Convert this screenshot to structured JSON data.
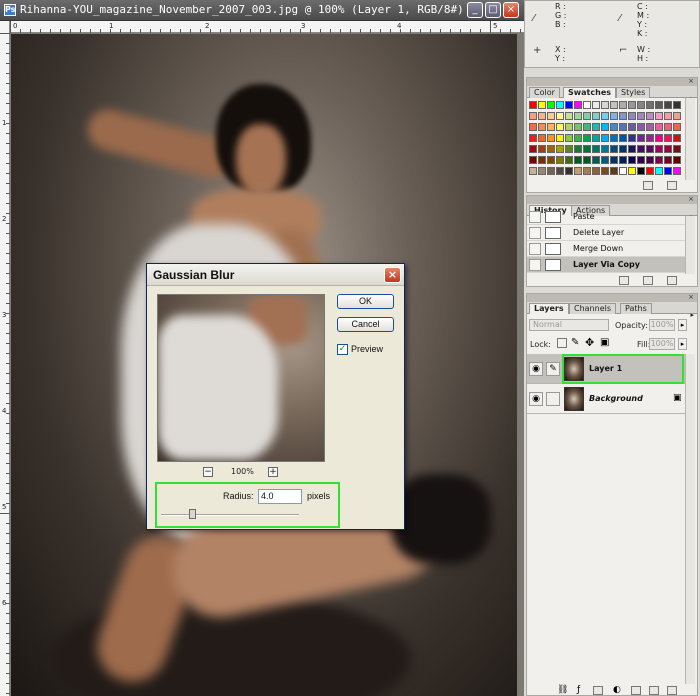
{
  "document": {
    "title": "Rihanna-YOU_magazine_November_2007_003.jpg @ 100% (Layer 1, RGB/8#)",
    "icon": "Ps",
    "minimize": "_",
    "maximize": "□",
    "close": "×"
  },
  "rulers": {
    "top": [
      "0",
      "1",
      "2",
      "3",
      "4",
      "5"
    ],
    "left": [
      "1",
      "2",
      "3",
      "4",
      "5",
      "6"
    ]
  },
  "info": {
    "rgb": [
      "R :",
      "G :",
      "B :"
    ],
    "cmyk": [
      "C :",
      "M :",
      "Y :",
      "K :"
    ],
    "xy": [
      "X :",
      "Y :"
    ],
    "wh": [
      "W :",
      "H :"
    ]
  },
  "swatches_panel": {
    "tabs": [
      "Color",
      "Swatches",
      "Styles"
    ],
    "active_tab": "Swatches",
    "colors": [
      [
        "#ff0000",
        "#ffff00",
        "#00ff00",
        "#00ffff",
        "#0000ff",
        "#ff00ff",
        "#ffffff",
        "#ebebeb",
        "#d6d6d6",
        "#c2c2c2",
        "#adadad",
        "#999999",
        "#858585",
        "#707070",
        "#5c5c5c",
        "#474747",
        "#333333",
        "#1f1f1f",
        "#000000"
      ],
      [
        "#f4a083",
        "#f6b48c",
        "#f9cd92",
        "#fff799",
        "#c5df9c",
        "#9fd49b",
        "#7ecda5",
        "#7ecfcd",
        "#71cff4",
        "#7fb2e6",
        "#8496d0",
        "#8f86c3",
        "#a186bd",
        "#bf8cc1",
        "#f29bc6",
        "#f39aa7",
        "#f19f91",
        "#c1c1c1",
        "#9a9a9a"
      ],
      [
        "#ee6b4d",
        "#f28c54",
        "#f6b559",
        "#fff462",
        "#acd46a",
        "#7ac36c",
        "#43b87a",
        "#22b9b4",
        "#00b9ef",
        "#3f8bd1",
        "#5873b8",
        "#6a5ba7",
        "#8a5aa4",
        "#ae5aa6",
        "#ec5f9f",
        "#ee5f7b",
        "#ed6454",
        "#8a8a8a",
        "#5c5c5c"
      ],
      [
        "#ec1c24",
        "#f26522",
        "#f7941d",
        "#fff200",
        "#8dc63f",
        "#39b54a",
        "#00a651",
        "#00a99d",
        "#00aeef",
        "#0072bc",
        "#0054a6",
        "#2e3192",
        "#662d91",
        "#92278f",
        "#ec008c",
        "#ed145b",
        "#c4151c",
        "#404040",
        "#262626"
      ],
      [
        "#9e0b0f",
        "#a0410d",
        "#a3620a",
        "#aba000",
        "#598527",
        "#197b30",
        "#007236",
        "#00746b",
        "#0076a3",
        "#004b80",
        "#003471",
        "#1b1464",
        "#440e62",
        "#630460",
        "#9e005d",
        "#9e0039",
        "#7a0b0f",
        "#1a1a1a",
        "#000000"
      ],
      [
        "#790000",
        "#7b2e00",
        "#7d4900",
        "#827b00",
        "#406618",
        "#005e20",
        "#005826",
        "#005952",
        "#005b7f",
        "#003663",
        "#002157",
        "#0d004c",
        "#32004b",
        "#4b0049",
        "#7b0046",
        "#7a0026",
        "#5e0000",
        "#000000",
        "#111111"
      ],
      [
        "#c7b299",
        "#998675",
        "#736357",
        "#534741",
        "#37302d",
        "#c69c6d",
        "#a67c52",
        "#8c6239",
        "#754c24",
        "#603913",
        "#ffffff",
        "#ffff00",
        "#000000",
        "#ff0000",
        "#00ffff",
        "#0000ff",
        "#ff00ff",
        "#00ff00",
        "#888888"
      ]
    ]
  },
  "history_panel": {
    "tabs": [
      "History",
      "Actions"
    ],
    "active_tab": "History",
    "items": [
      {
        "label": "Paste",
        "selected": false
      },
      {
        "label": "Delete Layer",
        "selected": false
      },
      {
        "label": "Merge Down",
        "selected": false
      },
      {
        "label": "Layer Via Copy",
        "selected": true
      }
    ]
  },
  "layers_panel": {
    "tabs": [
      "Layers",
      "Channels",
      "Paths"
    ],
    "active_tab": "Layers",
    "blend_mode": "Normal",
    "opacity_label": "Opacity:",
    "opacity": "100%",
    "lock_label": "Lock:",
    "fill_label": "Fill:",
    "fill": "100%",
    "layers": [
      {
        "name": "Layer 1",
        "selected": true,
        "visible": true
      },
      {
        "name": "Background",
        "selected": false,
        "visible": true,
        "locked": true
      }
    ]
  },
  "dialog": {
    "title": "Gaussian Blur",
    "close": "×",
    "ok_label": "OK",
    "cancel_label": "Cancel",
    "preview_checked": true,
    "preview_label": "Preview",
    "zoom_minus": "−",
    "zoom_plus": "+",
    "zoom_level": "100%",
    "radius_label": "Radius:",
    "radius_value": "4.0",
    "radius_unit": "pixels",
    "radius_slider_fraction": 0.2
  },
  "accent": {
    "highlight": "#33e033"
  }
}
